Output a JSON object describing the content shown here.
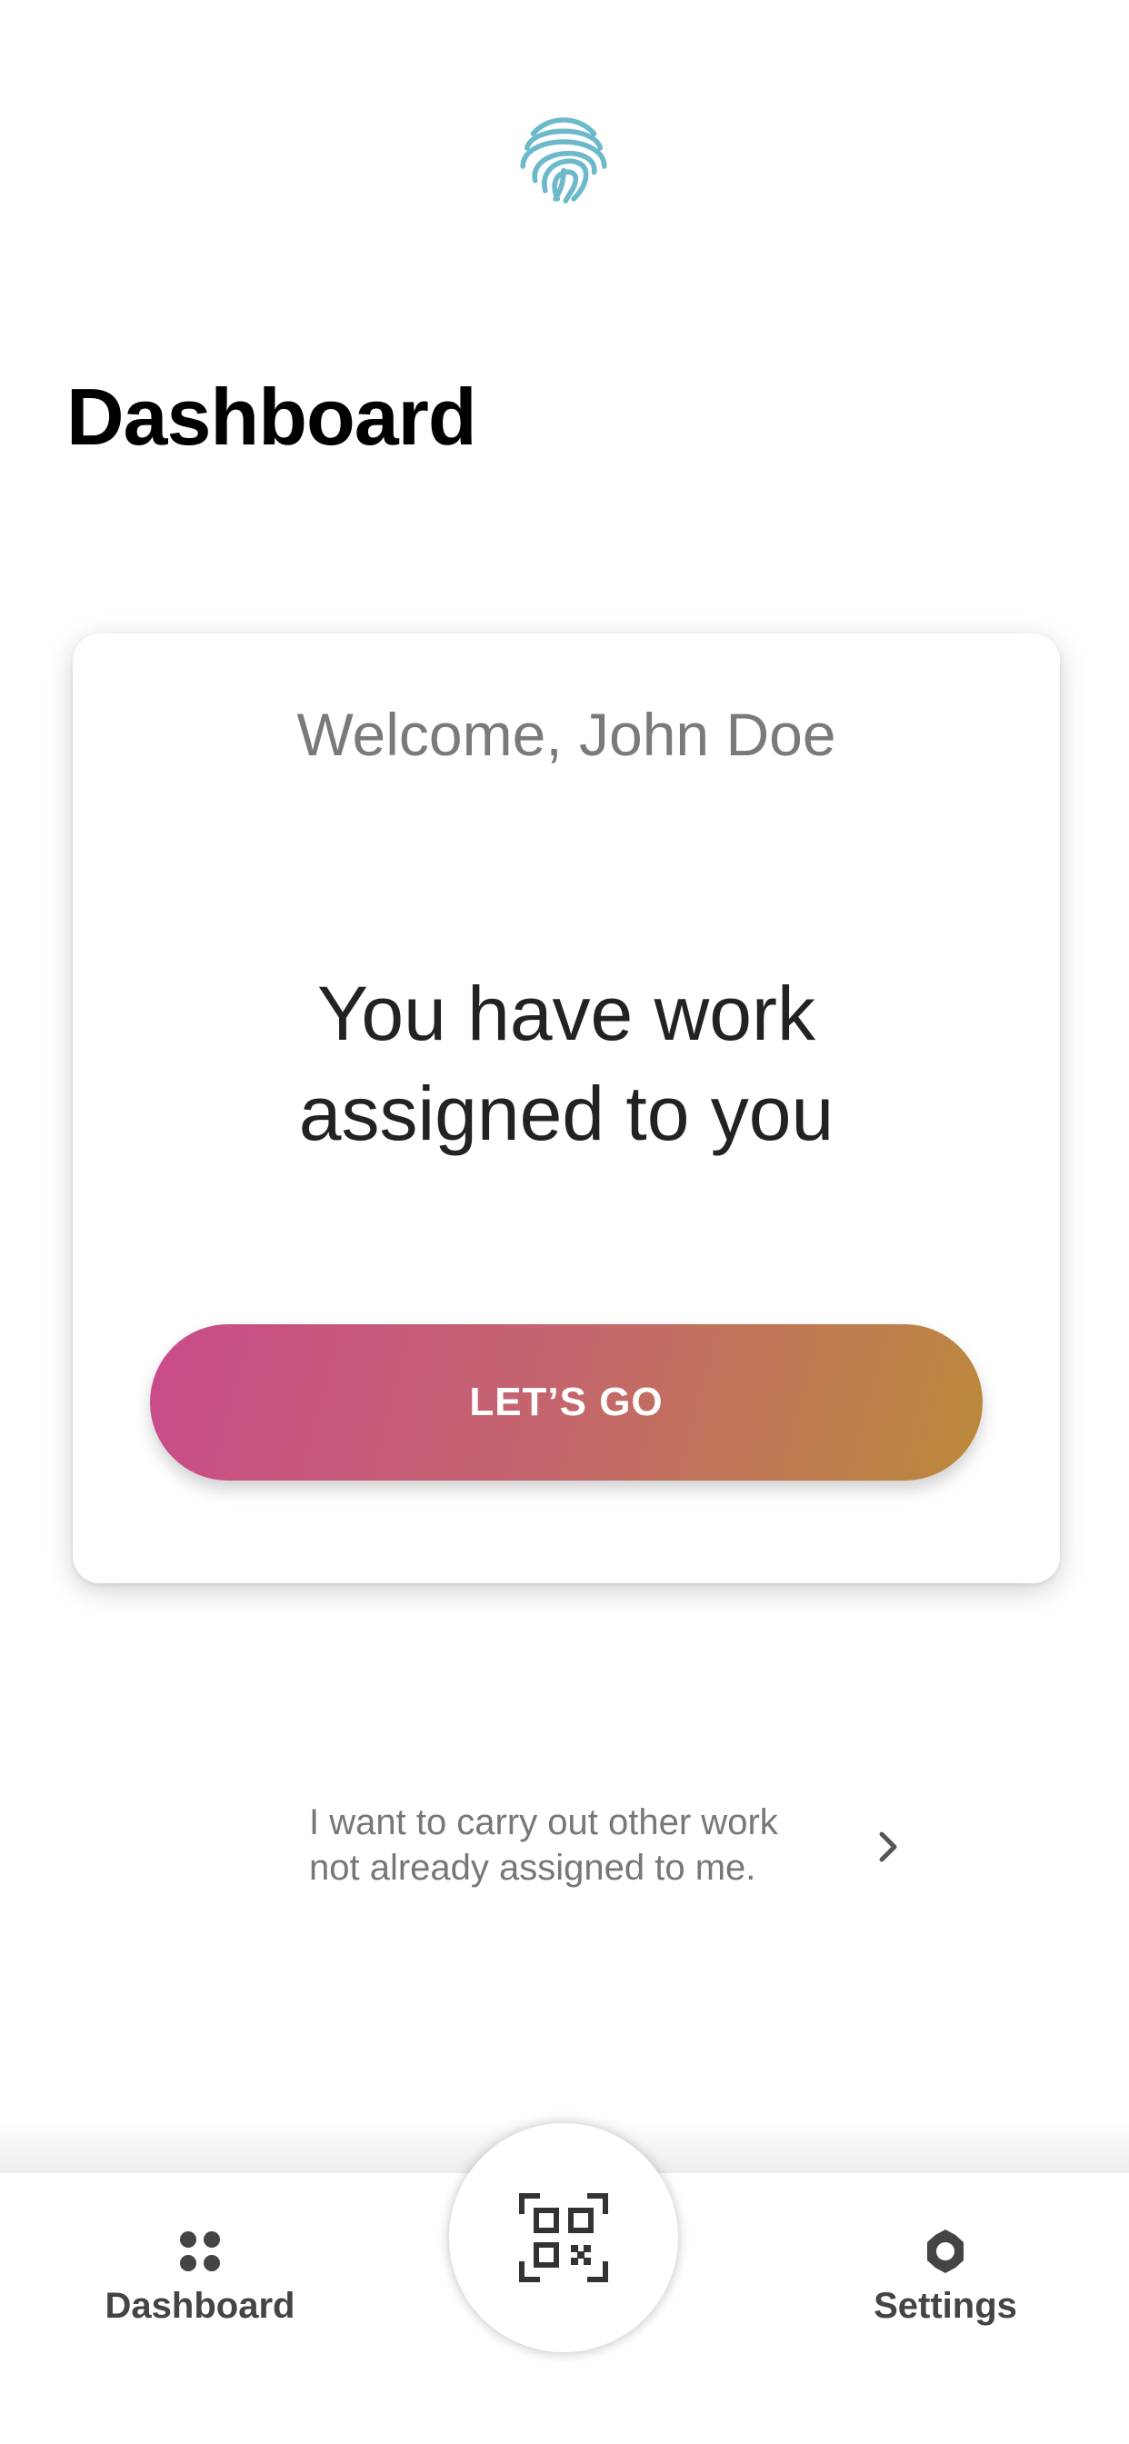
{
  "header": {
    "title": "Dashboard",
    "logo_icon": "fingerprint-icon",
    "logo_color": "#6db9cc"
  },
  "card": {
    "welcome": "Welcome, John Doe",
    "headline_line1": "You have work",
    "headline_line2": "assigned to you",
    "cta_label": "LET’S GO",
    "cta_gradient": [
      "#c94b8a",
      "#bb8a3a"
    ]
  },
  "other_work": {
    "line1": "I want to carry out other work",
    "line2": "not already assigned to me."
  },
  "tabbar": {
    "dashboard_label": "Dashboard",
    "settings_label": "Settings",
    "scan_icon": "qr-code-scan-icon"
  }
}
